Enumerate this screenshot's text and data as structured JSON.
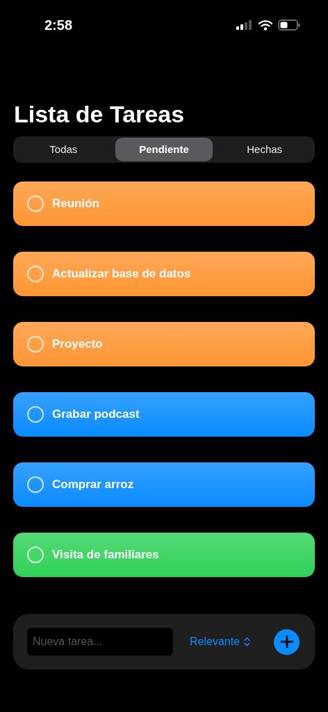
{
  "status_bar": {
    "time": "2:58"
  },
  "title": "Lista de Tareas",
  "tabs": [
    {
      "label": "Todas",
      "selected": false
    },
    {
      "label": "Pendiente",
      "selected": true
    },
    {
      "label": "Hechas",
      "selected": false
    }
  ],
  "tasks": [
    {
      "title": "Reunión",
      "checked": false,
      "color": "#ff9533"
    },
    {
      "title": "Actualizar base de datos",
      "checked": false,
      "color": "#ff9533"
    },
    {
      "title": "Proyecto",
      "checked": false,
      "color": "#ff9533"
    },
    {
      "title": "Grabar podcast",
      "checked": false,
      "color": "#0a8bff"
    },
    {
      "title": "Comprar arroz",
      "checked": false,
      "color": "#0a8bff"
    },
    {
      "title": "Visita de familiares",
      "checked": false,
      "color": "#30d158"
    }
  ],
  "composer": {
    "placeholder": "Nueva tarea...",
    "sort": "Relevante"
  }
}
